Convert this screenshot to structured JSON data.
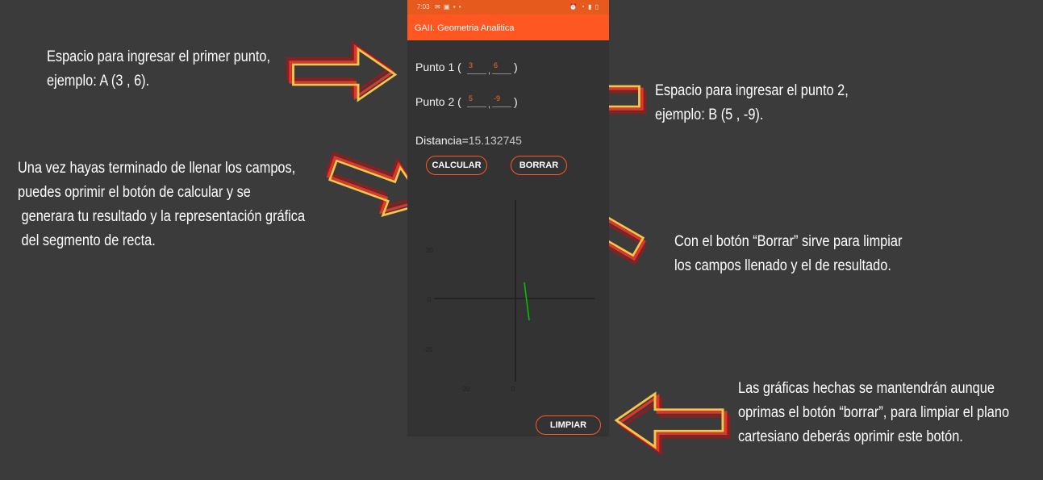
{
  "app": {
    "status_time": "7:03",
    "title": "GAII. Geometria Analitica"
  },
  "point1": {
    "label": "Punto 1 (",
    "x": "3",
    "y": "6",
    "sep": ",",
    "close": ")"
  },
  "point2": {
    "label": "Punto 2 (",
    "x": "5",
    "y": "-9",
    "sep": ",",
    "close": ")"
  },
  "distance": {
    "label": "Distancia=",
    "value": "15.132745"
  },
  "buttons": {
    "calcular": "CALCULAR",
    "borrar": "BORRAR",
    "limpiar": "LIMPIAR"
  },
  "plot": {
    "ticks_y": [
      "20",
      "0",
      "-20"
    ],
    "ticks_x": [
      "-20",
      "0"
    ],
    "segment_color": "#00c800"
  },
  "annotations": {
    "punto1": "Espacio para ingresar el primer punto,\nejemplo: A (3 , 6).",
    "punto2": "Espacio para ingresar el punto 2,\nejemplo: B (5 , -9).",
    "calcular": "Una vez hayas terminado de llenar los campos,\npuedes oprimir el botón de calcular y se\n generara tu resultado y la representación gráfica\n del segmento de recta.",
    "borrar": "Con el botón “Borrar” sirve para limpiar\nlos campos llenado y el de resultado.",
    "limpiar": "Las gráficas hechas se mantendrán aunque\noprimas el botón “borrar”, para limpiar el plano\ncartesiano deberás oprimir este botón."
  },
  "colors": {
    "background": "#3b3b3b",
    "accent": "#ff5722",
    "arrow_red": "#e3342a",
    "arrow_yellow": "#f5c64b"
  }
}
